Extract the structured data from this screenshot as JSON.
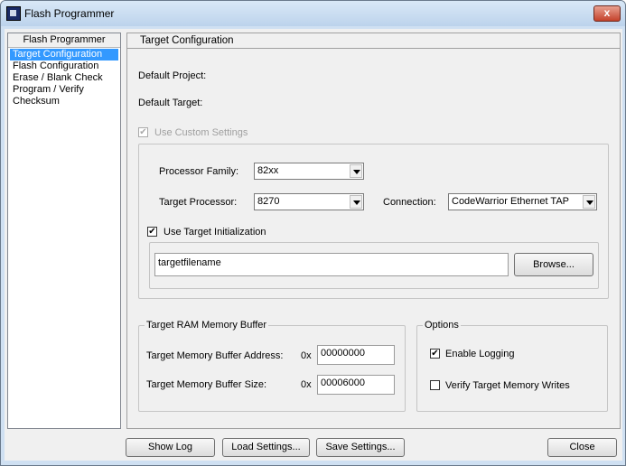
{
  "window": {
    "title": "Flash Programmer",
    "close_glyph": "x"
  },
  "sidebar": {
    "header": "Flash Programmer",
    "items": [
      {
        "label": "Target Configuration",
        "selected": true
      },
      {
        "label": "Flash Configuration"
      },
      {
        "label": "Erase / Blank Check"
      },
      {
        "label": "Program / Verify"
      },
      {
        "label": "Checksum"
      }
    ]
  },
  "panel": {
    "title": "Target Configuration",
    "default_project_label": "Default Project:",
    "default_target_label": "Default Target:",
    "use_custom_settings": {
      "label": "Use Custom Settings",
      "checked": true,
      "enabled": false
    },
    "processor_family": {
      "label": "Processor Family:",
      "value": "82xx"
    },
    "target_processor": {
      "label": "Target Processor:",
      "value": "8270"
    },
    "connection": {
      "label": "Connection:",
      "value": "CodeWarrior Ethernet TAP"
    },
    "use_target_init": {
      "label": "Use Target Initialization",
      "checked": true
    },
    "init_file": {
      "value": "targetfilename"
    },
    "browse_button": "Browse...",
    "ram_buffer": {
      "legend": "Target RAM Memory Buffer",
      "address_label": "Target Memory Buffer Address:",
      "address_prefix": "0x",
      "address_value": "00000000",
      "size_label": "Target Memory Buffer Size:",
      "size_prefix": "0x",
      "size_value": "00006000"
    },
    "options": {
      "legend": "Options",
      "enable_logging": {
        "label": "Enable Logging",
        "checked": true
      },
      "verify_writes": {
        "label": "Verify Target Memory Writes",
        "checked": false
      }
    }
  },
  "footer": {
    "show_log": "Show Log",
    "load_settings": "Load Settings...",
    "save_settings": "Save Settings...",
    "close": "Close"
  },
  "glyphs": {
    "check": "✔"
  }
}
